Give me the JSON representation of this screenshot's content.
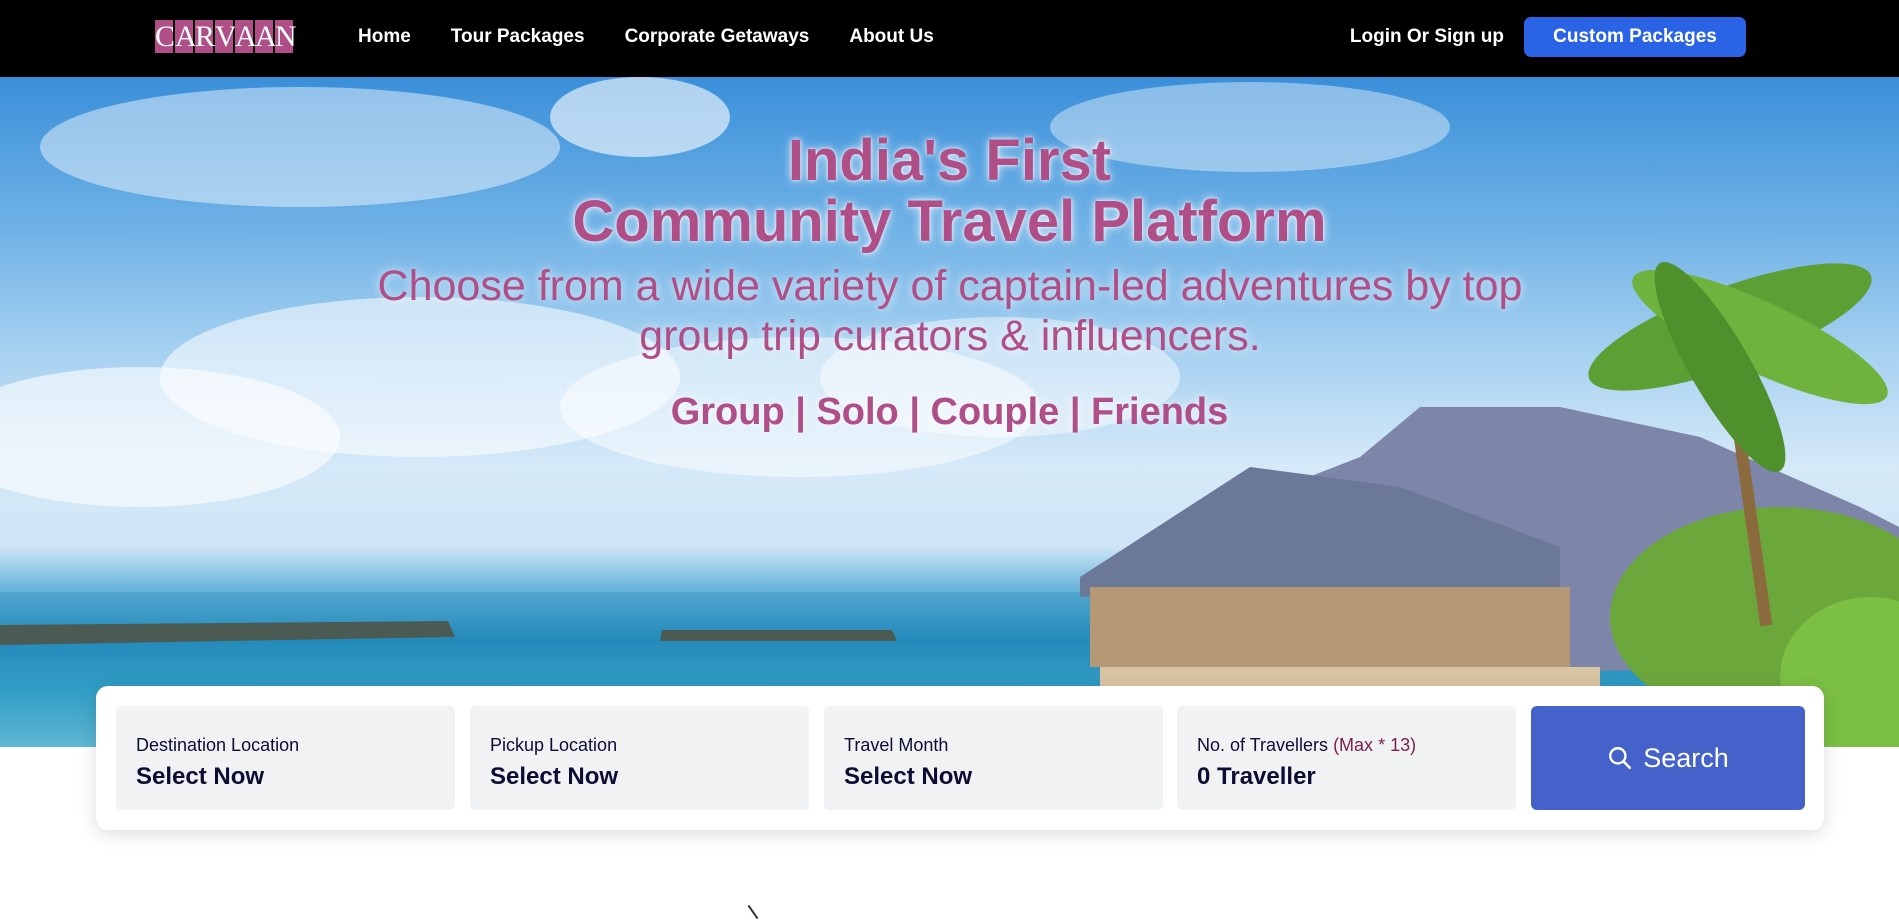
{
  "brand": {
    "letters": [
      "C",
      "A",
      "R",
      "V",
      "A",
      "A",
      "N"
    ],
    "color": "#b04e87"
  },
  "nav": {
    "links": [
      "Home",
      "Tour Packages",
      "Corporate Getaways",
      "About Us"
    ],
    "login": "Login Or Sign up",
    "cta": "Custom Packages",
    "cta_color": "#2b63e6"
  },
  "hero": {
    "title_line1": "India's First",
    "title_line2": "Community Travel Platform",
    "subtitle": "Choose from a wide variety of captain-led adventures by top group trip curators & influencers.",
    "tags": "Group | Solo | Couple | Friends",
    "text_color": "#b04e87"
  },
  "search": {
    "fields": [
      {
        "label": "Destination Location",
        "value": "Select Now"
      },
      {
        "label": "Pickup Location",
        "value": "Select Now"
      },
      {
        "label": "Travel Month",
        "value": "Select Now"
      },
      {
        "label": "No. of Travellers",
        "label_suffix": "(Max * 13)",
        "value": "0 Traveller"
      }
    ],
    "button_label": "Search",
    "button_icon": "search-icon",
    "button_color": "#4462c9"
  }
}
